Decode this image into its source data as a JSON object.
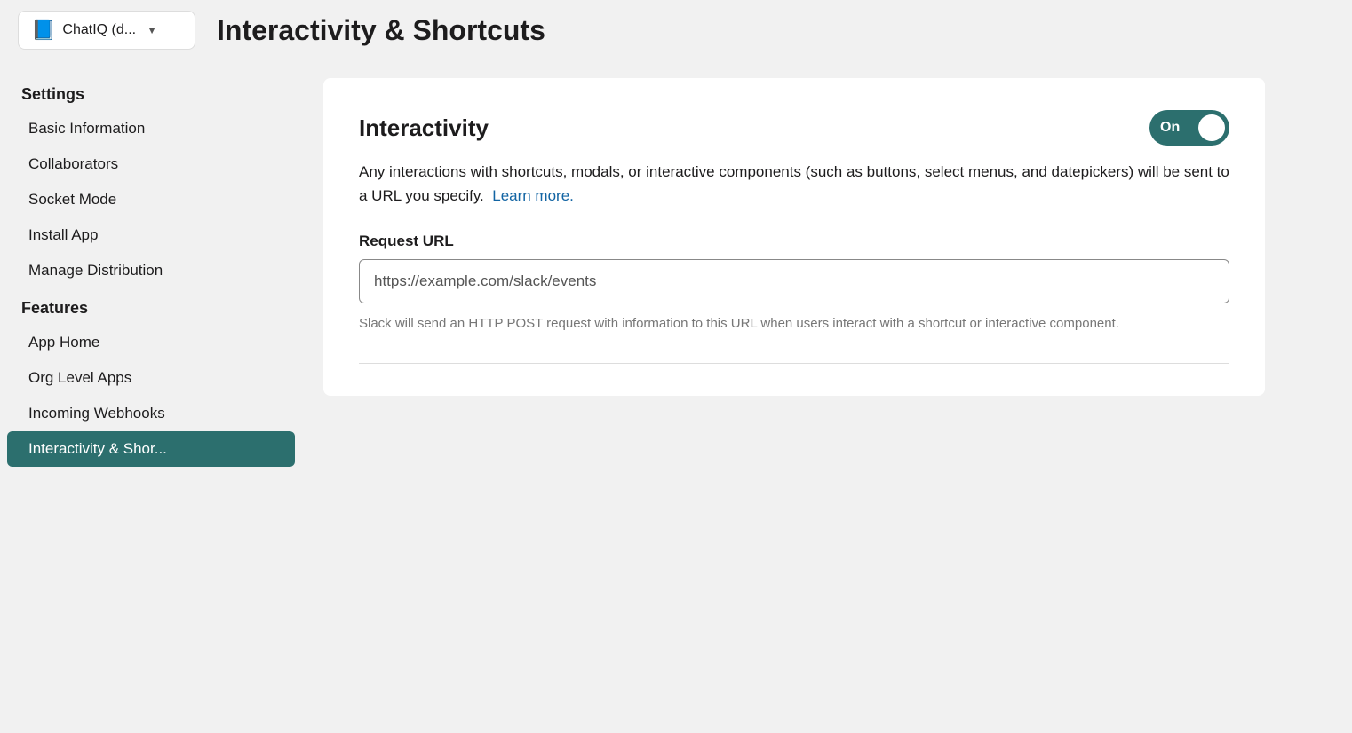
{
  "app": {
    "icon": "📘",
    "name": "ChatIQ (d...",
    "chevron": "▼"
  },
  "page_title": "Interactivity & Shortcuts",
  "sidebar": {
    "settings_label": "Settings",
    "settings_items": [
      {
        "id": "basic-information",
        "label": "Basic Information",
        "active": false
      },
      {
        "id": "collaborators",
        "label": "Collaborators",
        "active": false
      },
      {
        "id": "socket-mode",
        "label": "Socket Mode",
        "active": false
      },
      {
        "id": "install-app",
        "label": "Install App",
        "active": false
      },
      {
        "id": "manage-distribution",
        "label": "Manage Distribution",
        "active": false
      }
    ],
    "features_label": "Features",
    "features_items": [
      {
        "id": "app-home",
        "label": "App Home",
        "active": false
      },
      {
        "id": "org-level-apps",
        "label": "Org Level Apps",
        "active": false
      },
      {
        "id": "incoming-webhooks",
        "label": "Incoming Webhooks",
        "active": false
      },
      {
        "id": "interactivity-shortcuts",
        "label": "Interactivity & Shor...",
        "active": true
      }
    ]
  },
  "main": {
    "section_title": "Interactivity",
    "toggle_label": "On",
    "toggle_on": true,
    "description": "Any interactions with shortcuts, modals, or interactive components (such as buttons, select menus, and datepickers) will be sent to a URL you specify.",
    "learn_more_label": "Learn more.",
    "learn_more_url": "#",
    "request_url_label": "Request URL",
    "request_url_value": "https://example.com/slack/events",
    "request_url_hint": "Slack will send an HTTP POST request with information to this URL when users interact with a shortcut or interactive component."
  }
}
